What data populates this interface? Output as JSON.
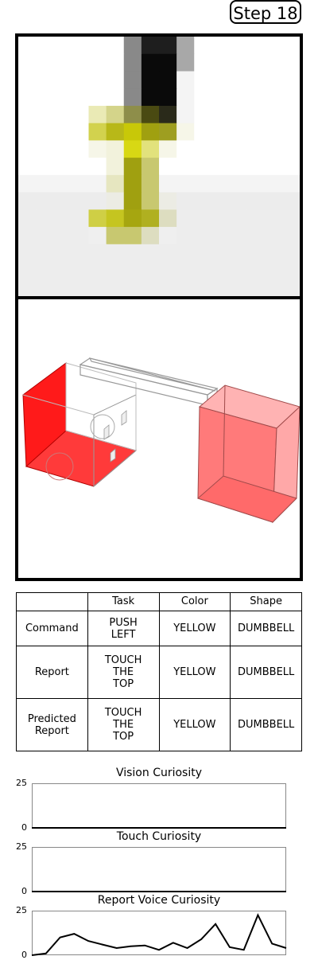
{
  "step_label": "Step 18",
  "vision_image": {
    "colors": [
      "#ffffff",
      "#f4f4f4",
      "#ececec",
      "#ededed",
      "#898989",
      "#1e1e1e",
      "#0a0a0a",
      "#a8a8a8",
      "#eaeab5",
      "#d4d48a",
      "#8e8e4a",
      "#4a4a12",
      "#2a2a1a",
      "#d2d24e",
      "#b8b818",
      "#c8c808",
      "#a0a010",
      "#9e9e20",
      "#f6f6e8",
      "#d8d814",
      "#e2e27c",
      "#c8c870",
      "#f2f2dc",
      "#e6e6c0",
      "#ecece4",
      "#cfcf45",
      "#c5c520",
      "#a6a610",
      "#b0b020",
      "#ddddc0",
      "#efefef"
    ]
  },
  "table": {
    "headers": [
      "",
      "Task",
      "Color",
      "Shape"
    ],
    "rows": [
      {
        "label": "Command",
        "task": "PUSH\nLEFT",
        "color": "YELLOW",
        "shape": "DUMBBELL"
      },
      {
        "label": "Report",
        "task": "TOUCH\nTHE\nTOP",
        "color": "YELLOW",
        "shape": "DUMBBELL"
      },
      {
        "label": "Predicted\nReport",
        "task": "TOUCH\nTHE\nTOP",
        "color": "YELLOW",
        "shape": "DUMBBELL"
      }
    ]
  },
  "chart_data": [
    {
      "type": "line",
      "title": "Vision Curiosity",
      "ylim": [
        0,
        25
      ],
      "yticks": [
        0,
        25
      ],
      "series": [
        {
          "values": [
            0,
            0,
            0,
            0,
            0,
            0,
            0,
            0,
            0,
            0,
            0,
            0,
            0,
            0,
            0,
            0,
            0,
            0,
            0,
            0,
            0
          ]
        }
      ]
    },
    {
      "type": "line",
      "title": "Touch Curiosity",
      "ylim": [
        0,
        25
      ],
      "yticks": [
        0,
        25
      ],
      "series": [
        {
          "values": [
            0,
            0,
            0,
            0,
            0,
            0,
            0,
            0,
            0,
            0,
            0,
            0,
            0,
            0,
            0,
            0,
            0,
            0,
            0,
            0,
            0
          ]
        }
      ]
    },
    {
      "type": "line",
      "title": "Report Voice Curiosity",
      "ylim": [
        0,
        25
      ],
      "yticks": [
        0,
        25
      ],
      "series": [
        {
          "values": [
            0,
            1,
            10,
            12,
            8,
            6,
            4,
            5,
            5.5,
            3,
            7,
            4,
            9,
            17.5,
            4.5,
            3,
            22.5,
            6.5,
            4
          ]
        }
      ]
    }
  ]
}
